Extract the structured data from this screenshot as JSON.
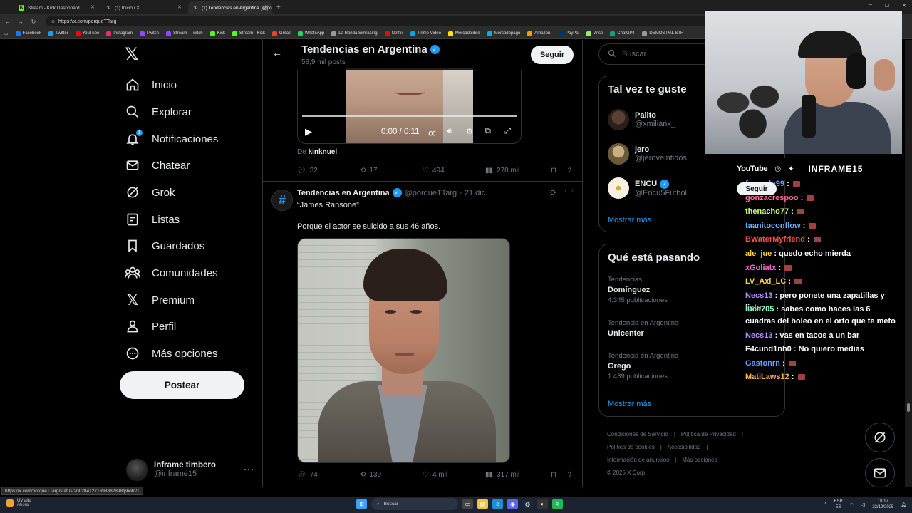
{
  "browser": {
    "tabs": [
      {
        "title": "Stream - Kick Dashboard",
        "active": false,
        "icon": "kick-icon",
        "color": "#53fc18"
      },
      {
        "title": "(1) Inicio / X",
        "active": false,
        "icon": "x-icon",
        "color": "#ffffff"
      },
      {
        "title": "(1) Tendencias en Argentina (@po",
        "active": true,
        "icon": "x-icon",
        "color": "#ffffff"
      }
    ],
    "new_tab": "+",
    "url": "https://x.com/porqueTTarg",
    "bookmarks": [
      {
        "label": "Facebook",
        "color": "#1877f2"
      },
      {
        "label": "Twitter",
        "color": "#1d9bf0"
      },
      {
        "label": "YouTube",
        "color": "#ff0000"
      },
      {
        "label": "Instagram",
        "color": "#e1306c"
      },
      {
        "label": "Twitch",
        "color": "#9146ff"
      },
      {
        "label": "Stream - Twitch",
        "color": "#9146ff"
      },
      {
        "label": "Kick",
        "color": "#53fc18"
      },
      {
        "label": "Stream - Kick",
        "color": "#53fc18"
      },
      {
        "label": "Gmail",
        "color": "#ea4335"
      },
      {
        "label": "WhatsApp",
        "color": "#25d366"
      },
      {
        "label": "La Ronda Simracing",
        "color": "#999999"
      },
      {
        "label": "Netflix",
        "color": "#e50914"
      },
      {
        "label": "Prime Video",
        "color": "#00a8e1"
      },
      {
        "label": "Mercadolibre",
        "color": "#ffe600"
      },
      {
        "label": "Mercadopago",
        "color": "#00b1ea"
      },
      {
        "label": "Amazon.",
        "color": "#ff9900"
      },
      {
        "label": "PayPal",
        "color": "#003087"
      },
      {
        "label": "Wise",
        "color": "#9fe870"
      },
      {
        "label": "ChatGPT",
        "color": "#10a37f"
      },
      {
        "label": "DEMOS PAL STR",
        "color": "#999999"
      }
    ],
    "status_url": "https://x.com/porqueTTarg/status/2002841271698882898/photo/1"
  },
  "sidebar": {
    "logo": "𝕏",
    "items": [
      {
        "label": "Inicio",
        "icon": "home-icon"
      },
      {
        "label": "Explorar",
        "icon": "search-icon"
      },
      {
        "label": "Notificaciones",
        "icon": "bell-icon",
        "badge": "1"
      },
      {
        "label": "Chatear",
        "icon": "mail-icon"
      },
      {
        "label": "Grok",
        "icon": "grok-icon"
      },
      {
        "label": "Listas",
        "icon": "list-icon"
      },
      {
        "label": "Guardados",
        "icon": "bookmark-icon"
      },
      {
        "label": "Comunidades",
        "icon": "communities-icon"
      },
      {
        "label": "Premium",
        "icon": "x-premium-icon"
      },
      {
        "label": "Perfil",
        "icon": "person-icon"
      },
      {
        "label": "Más opciones",
        "icon": "more-icon"
      }
    ],
    "post_button": "Postear",
    "account": {
      "name": "Inframe timbero",
      "handle": "@inframe15",
      "more": "···"
    }
  },
  "main": {
    "header": {
      "title": "Tendencias en Argentina",
      "posts": "58,9 mil posts",
      "follow": "Seguir"
    },
    "video": {
      "time": "0:00 / 0:11"
    },
    "from_label": "De",
    "from_user": "kinknuel",
    "tweet1_actions": {
      "replies": "32",
      "reposts": "17",
      "likes": "494",
      "views": "278 mil"
    },
    "tweet2": {
      "name": "Tendencias en Argentina",
      "handle": "@porqueTTarg",
      "date": "· 21 dic.",
      "text1": "“James Ransone”",
      "text2": "Porque el actor se suicido a sus 46 años.",
      "actions": {
        "replies": "74",
        "reposts": "139",
        "likes": "4 mil",
        "views": "317 mil"
      }
    }
  },
  "right": {
    "search_placeholder": "Buscar",
    "who_to_follow": {
      "title": "Tal vez te guste",
      "users": [
        {
          "name": "Palito",
          "handle": "@xmilianx_",
          "verified": false,
          "color": "#3a2a22"
        },
        {
          "name": "jero",
          "handle": "@jeroveintidos",
          "verified": false,
          "color": "#8a7a55"
        },
        {
          "name": "ENCU",
          "handle": "@Encu5Futbol",
          "verified": true,
          "color": "#f5f0e0"
        }
      ],
      "show_more": "Mostrar más"
    },
    "trends": {
      "title": "Qué está pasando",
      "items": [
        {
          "context": "Tendencias",
          "name": "Domínguez",
          "count": "4.345 publicaciones"
        },
        {
          "context": "Tendencia en Argentina",
          "name": "Unicenter",
          "count": ""
        },
        {
          "context": "Tendencia en Argentina",
          "name": "Grego",
          "count": "1.489 publicaciones"
        }
      ],
      "show_more": "Mostrar más"
    },
    "footer": {
      "links": [
        "Condiciones de Servicio",
        "|",
        "Política de Privacidad",
        "|",
        "Política de cookies",
        "|",
        "Accesibilidad",
        "|",
        "Información de anuncios",
        "|",
        "Más opciones ···"
      ],
      "copyright": "© 2025 X Corp."
    }
  },
  "overlay": {
    "brand": {
      "youtube": "YouTube",
      "name": "INFRAME15"
    },
    "seguir": "Seguir",
    "chat": [
      {
        "user": "facundo99",
        "msg": "",
        "color": "#6aa0ff",
        "emote": true
      },
      {
        "user": "gonzacrespoo",
        "msg": "",
        "color": "#ff6a9a",
        "emote": true
      },
      {
        "user": "thenacho77",
        "msg": "",
        "color": "#c8ff6a",
        "emote": true
      },
      {
        "user": "taanitoconflow",
        "msg": "",
        "color": "#6ab4ff",
        "emote": true
      },
      {
        "user": "BWaterMyfriend",
        "msg": "",
        "color": "#ff4d4d",
        "emote": true
      },
      {
        "user": "ale_jue",
        "msg": "quedo echo mierda",
        "color": "#ffd24d",
        "emote": false
      },
      {
        "user": "xGoliatx",
        "msg": "",
        "color": "#ff6adf",
        "emote": true
      },
      {
        "user": "LV_Axl_LC",
        "msg": "",
        "color": "#ffd24d",
        "emote": true
      },
      {
        "user": "Necs13",
        "msg": "pero ponete una zapatillas y listo",
        "color": "#b88cff",
        "emote": false
      },
      {
        "user": "luca705",
        "msg": "sabes como haces las 6 cuadras del boleo en el orto que te meto",
        "color": "#8affc4",
        "emote": false
      },
      {
        "user": "Necs13",
        "msg": "vas en tacos a un bar",
        "color": "#b88cff",
        "emote": false
      },
      {
        "user": "F4cund1nh0",
        "msg": "No quiero medias",
        "color": "#ffffff",
        "emote": false
      },
      {
        "user": "Gastonrn",
        "msg": "",
        "color": "#6aa0ff",
        "emote": true
      },
      {
        "user": "MatiLaws12",
        "msg": "",
        "color": "#ffb24d",
        "emote": true
      }
    ]
  },
  "taskbar": {
    "weather": {
      "title": "UV alto",
      "sub": "Ahora"
    },
    "search": "Buscar",
    "lang": {
      "top": "ESP",
      "bottom": "ES"
    },
    "clock": {
      "time": "18:17",
      "date": "22/12/2025"
    }
  }
}
